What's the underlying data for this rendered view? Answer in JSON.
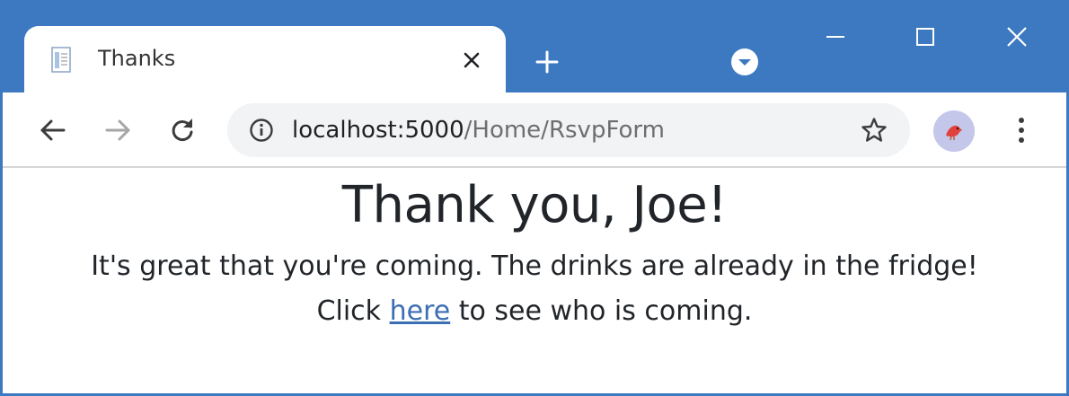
{
  "tab": {
    "title": "Thanks",
    "favicon": "page-icon",
    "close_icon": "close-icon"
  },
  "titlebar": {
    "new_tab_icon": "plus-icon",
    "tab_search_icon": "chevron-down-icon",
    "window_controls": [
      "minimize-icon",
      "maximize-icon",
      "close-icon"
    ]
  },
  "toolbar": {
    "back_icon": "arrow-left-icon",
    "forward_icon": "arrow-right-icon",
    "reload_icon": "reload-icon",
    "url_host": "localhost:5000",
    "url_path": "/Home/RsvpForm",
    "info_icon": "info-icon",
    "bookmark_icon": "star-icon",
    "profile_icon": "avatar-icon",
    "menu_icon": "kebab-menu-icon"
  },
  "page": {
    "heading": "Thank you, Joe!",
    "message": "It's great that you're coming. The drinks are already in the fridge!",
    "link_prefix": "Click ",
    "link_text": "here",
    "link_suffix": " to see who is coming."
  },
  "colors": {
    "frame": "#3c79c0",
    "omnibox_bg": "#f1f3f4",
    "link": "#3c6eb4",
    "text": "#212529",
    "avatar_bg": "#c4c6ea"
  }
}
